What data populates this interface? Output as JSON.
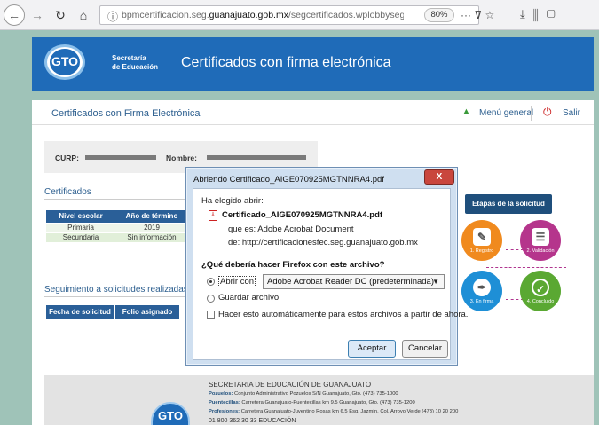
{
  "browser": {
    "url_prefix": "bpmcertificacion.seg.",
    "url_domain": "guanajuato.gob.mx",
    "url_path": "/segcertificados.wplobbyseg.asp",
    "zoom": "80%"
  },
  "header": {
    "logo_text": "GTO",
    "dept_line1": "Secretaría",
    "dept_line2": "de Educación",
    "title": "Certificados con firma electrónica"
  },
  "subheader": {
    "title": "Certificados con Firma Electrónica",
    "menu_label": "Menú general",
    "exit_label": "Salir"
  },
  "person": {
    "curp_label": "CURP:",
    "name_label": "Nombre:"
  },
  "certificates": {
    "heading": "Certificados",
    "columns": [
      "Nivel escolar",
      "Año de término"
    ],
    "rows": [
      [
        "Primaria",
        "2019"
      ],
      [
        "Secundaria",
        "Sin información"
      ]
    ]
  },
  "tracking": {
    "heading": "Seguimiento a solicitudes realizadas me",
    "columns": [
      "Fecha de solicitud",
      "Folio asignado"
    ]
  },
  "stages": {
    "heading": "Etapas de la solicitud",
    "items": [
      {
        "label": "1. Registro",
        "color": "#f08a1e",
        "icon": "edit-icon"
      },
      {
        "label": "2. Validación",
        "color": "#b5358c",
        "icon": "document-icon"
      },
      {
        "label": "3. En firma",
        "color": "#1e8fd6",
        "icon": "pen-icon"
      },
      {
        "label": "4. Concluido",
        "color": "#5aa832",
        "icon": "check-icon"
      }
    ]
  },
  "footer": {
    "title": "SECRETARIA DE EDUCACIÓN DE GUANAJUATO",
    "lines": [
      {
        "name": "Pozuelos:",
        "text": "Conjunto Administrativo Pozuelos S/N Guanajuato, Gto. (473) 735-1000"
      },
      {
        "name": "Puentecillas:",
        "text": "Carretera Guanajuato-Puentecillas km 9.5 Guanajuato, Gto. (473) 735-1200"
      },
      {
        "name": "Profesiones:",
        "text": "Carretera Guanajuato-Juventino Rosas km 6.5 Esq. Jazmín, Col. Arroyo Verde (473) 10 20 200"
      }
    ],
    "phone": "01 800 362 30 33  EDUCACIÓN"
  },
  "dialog": {
    "title": "Abriendo Certificado_AIGE070925MGTNNRA4.pdf",
    "close_label": "X",
    "chosen_label": "Ha elegido abrir:",
    "filename": "Certificado_AIGE070925MGTNNRA4.pdf",
    "type_line": "que es:  Adobe Acrobat Document",
    "from_line": "de:  http://certificacionesfec.seg.guanajuato.gob.mx",
    "question": "¿Qué debería hacer Firefox con este archivo?",
    "open_with_label": "Abrir con",
    "open_with_value": "Adobe Acrobat Reader DC  (predeterminada)",
    "save_label": "Guardar archivo",
    "auto_label": "Hacer esto automáticamente para estos archivos a partir de ahora.",
    "accept_label": "Aceptar",
    "cancel_label": "Cancelar"
  }
}
